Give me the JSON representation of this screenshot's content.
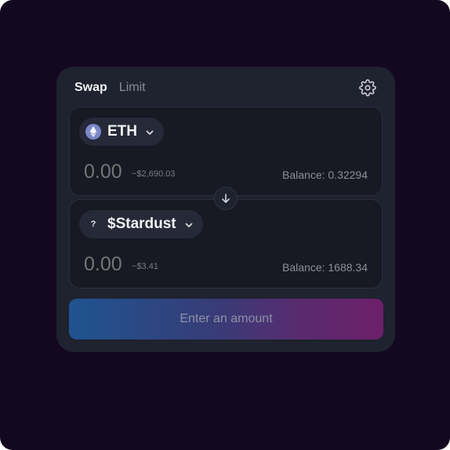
{
  "tabs": [
    {
      "label": "Swap",
      "active": true
    },
    {
      "label": "Limit",
      "active": false
    }
  ],
  "settings_icon": "gear-icon",
  "sell": {
    "token_symbol": "ETH",
    "token_icon": "eth-icon",
    "amount_placeholder": "0.00",
    "usd_value": "~$2,690.03",
    "balance": "Balance: 0.32294"
  },
  "flip_icon": "arrow-down-icon",
  "buy": {
    "token_symbol": "$Stardust",
    "token_icon": "unknown-token-icon",
    "token_icon_glyph": "?",
    "amount_placeholder": "0.00",
    "usd_value": "~$3.41",
    "balance": "Balance: 1688.34"
  },
  "action_button": {
    "label": "Enter an amount"
  },
  "colors": {
    "background": "#140820",
    "card": "#1f222f",
    "panel": "#171923",
    "gradient_start": "#1f5490",
    "gradient_end": "#6e1f6a"
  }
}
